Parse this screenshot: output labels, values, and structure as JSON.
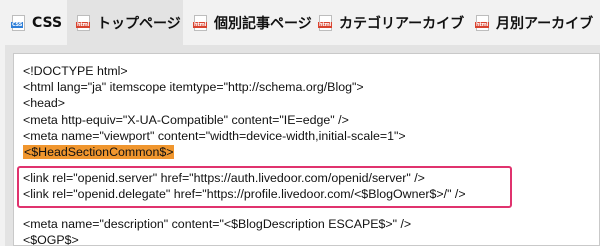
{
  "tabs": [
    {
      "label": "CSS",
      "icon": "css-file-icon",
      "icon_badge": "CSS",
      "active": false
    },
    {
      "label": "トップページ",
      "icon": "html-file-icon",
      "icon_badge": "html",
      "active": true
    },
    {
      "label": "個別記事ページ",
      "icon": "html-file-icon",
      "icon_badge": "html",
      "active": false
    },
    {
      "label": "カテゴリアーカイブ",
      "icon": "html-file-icon",
      "icon_badge": "html",
      "active": false
    },
    {
      "label": "月別アーカイブ",
      "icon": "html-file-icon",
      "icon_badge": "html",
      "active": false
    }
  ],
  "code": {
    "line1": "<!DOCTYPE html>",
    "line2": "<html lang=\"ja\" itemscope itemtype=\"http://schema.org/Blog\">",
    "line3": "<head>",
    "line4": "<meta http-equiv=\"X-UA-Compatible\" content=\"IE=edge\" />",
    "line5": "<meta name=\"viewport\" content=\"width=device-width,initial-scale=1\">",
    "line6_highlight": "<$HeadSectionCommon$>",
    "line7": "<link rel=\"openid.server\" href=\"https://auth.livedoor.com/openid/server\" />",
    "line8": "<link rel=\"openid.delegate\" href=\"https://profile.livedoor.com/<$BlogOwner$>/\" />",
    "line9": "<meta name=\"description\" content=\"<$BlogDescription ESCAPE$>\" />",
    "line10": "<$OGP$>"
  },
  "colors": {
    "highlight": "#f0962e",
    "annotation_box": "#e0336e",
    "css_badge": "#2f7fd8",
    "html_badge": "#d9432f"
  }
}
